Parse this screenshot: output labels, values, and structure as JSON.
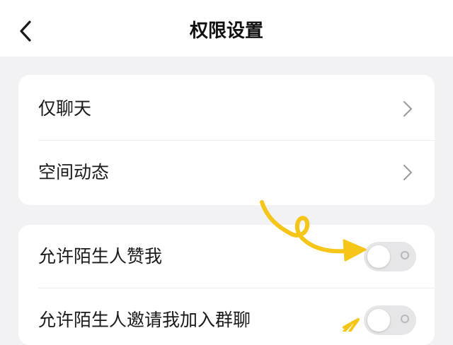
{
  "header": {
    "title": "权限设置",
    "back_icon": "chevron-left-icon"
  },
  "section1": {
    "items": [
      {
        "label": "仅聊天",
        "icon": "chevron-right-icon"
      },
      {
        "label": "空间动态",
        "icon": "chevron-right-icon"
      }
    ]
  },
  "section2": {
    "items": [
      {
        "label": "允许陌生人赞我",
        "toggle_on": false
      },
      {
        "label": "允许陌生人邀请我加入群聊",
        "toggle_on": false
      }
    ]
  },
  "colors": {
    "page_bg": "#f2f2f4",
    "card_bg": "#ffffff",
    "toggle_off": "#e6e6e8",
    "annotation": "#f5c518"
  }
}
